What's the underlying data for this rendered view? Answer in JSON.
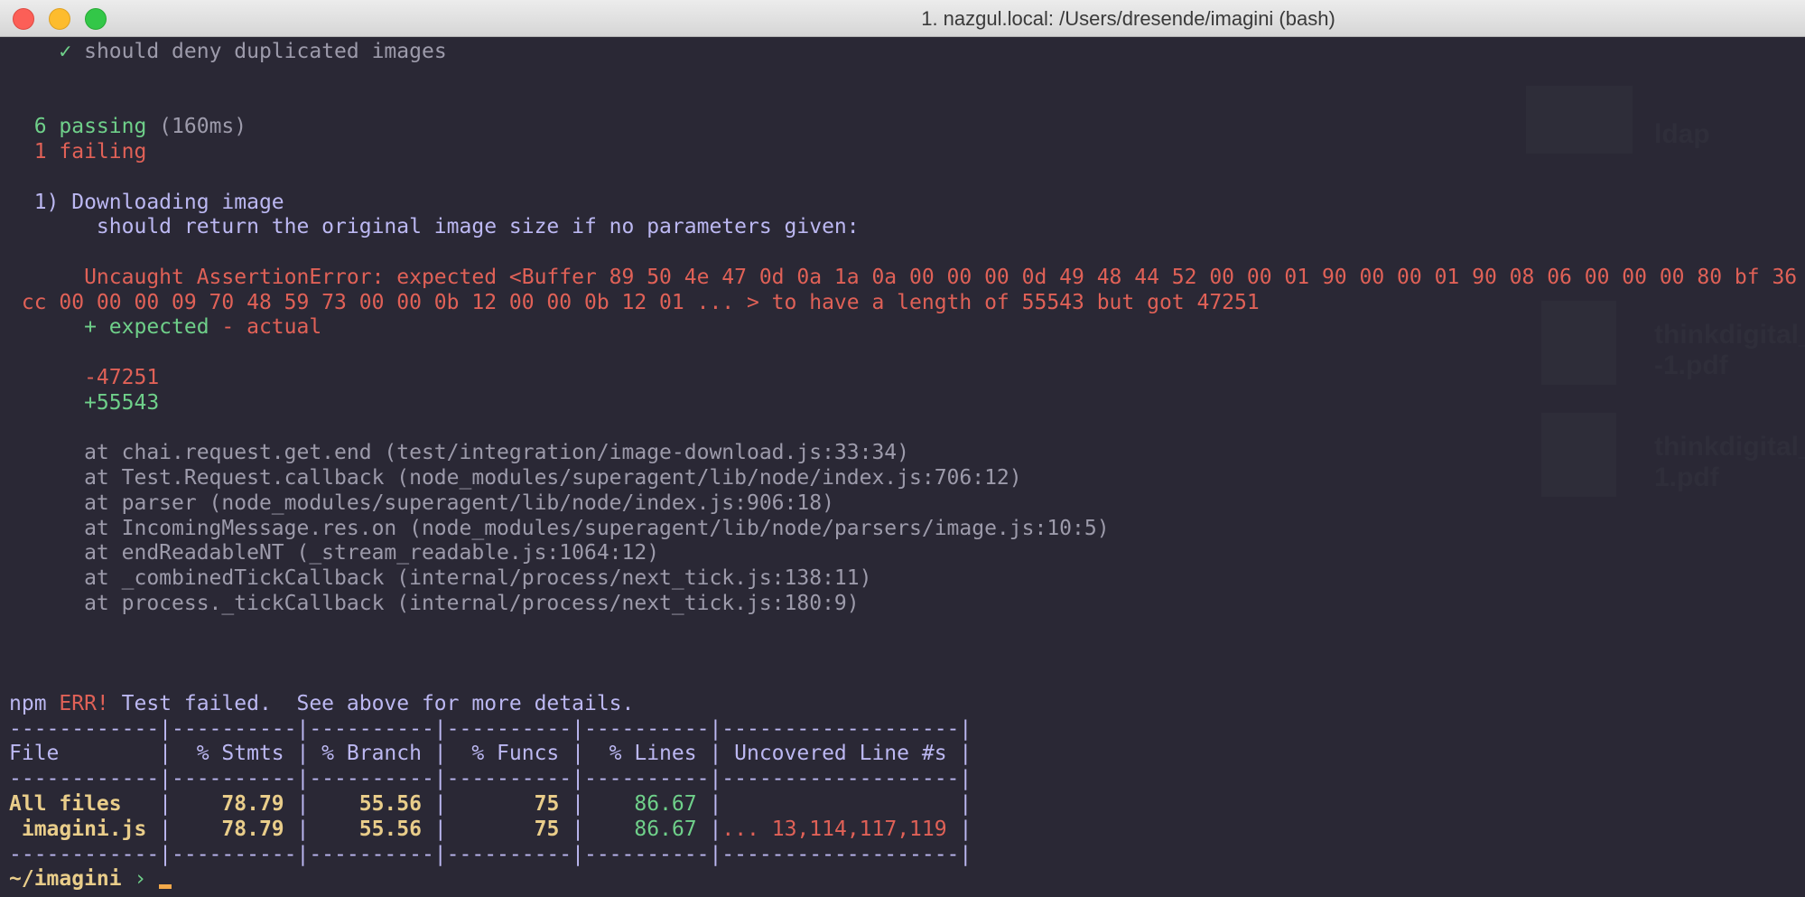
{
  "window": {
    "title": "1. nazgul.local: /Users/dresende/imagini (bash)"
  },
  "desktop": {
    "items": [
      "ldap",
      "thinkdigital_",
      "-1.pdf",
      "thinkdigital_",
      "1.pdf"
    ]
  },
  "colors": {
    "bg": "#2a2835",
    "purple": "#bcb8f2",
    "green": "#6fd08a",
    "red": "#e06157",
    "yellow": "#e9cd8a",
    "gray": "#9d9bab"
  },
  "lines": [
    [
      [
        "    ",
        "g"
      ],
      [
        "✓",
        "gr"
      ],
      [
        " should deny duplicated images",
        "g"
      ]
    ],
    [],
    [],
    [
      [
        "  6 passing",
        "gr"
      ],
      [
        " (160ms)",
        "g"
      ]
    ],
    [
      [
        "  1 failing",
        "r"
      ]
    ],
    [],
    [
      [
        "  1) Downloading image",
        "p"
      ]
    ],
    [
      [
        "       should return the original image size if no parameters given:",
        "p"
      ]
    ],
    [],
    [
      [
        "      Uncaught AssertionError: expected <Buffer 89 50 4e 47 0d 0a 1a 0a 00 00 00 0d 49 48 44 52 00 00 01 90 00 00 01 90 08 06 00 00 00 80 bf 36",
        "r"
      ]
    ],
    [
      [
        " cc 00 00 00 09 70 48 59 73 00 00 0b 12 00 00 0b 12 01 ... > to have a length of 55543 but got 47251",
        "r"
      ]
    ],
    [
      [
        "      + expected",
        "gr"
      ],
      [
        " - actual",
        "r"
      ]
    ],
    [],
    [
      [
        "      -47251",
        "r"
      ]
    ],
    [
      [
        "      +55543",
        "gr"
      ]
    ],
    [],
    [
      [
        "      at chai.request.get.end (test/integration/image-download.js:33:34)",
        "g"
      ]
    ],
    [
      [
        "      at Test.Request.callback (node_modules/superagent/lib/node/index.js:706:12)",
        "g"
      ]
    ],
    [
      [
        "      at parser (node_modules/superagent/lib/node/index.js:906:18)",
        "g"
      ]
    ],
    [
      [
        "      at IncomingMessage.res.on (node_modules/superagent/lib/node/parsers/image.js:10:5)",
        "g"
      ]
    ],
    [
      [
        "      at endReadableNT (_stream_readable.js:1064:12)",
        "g"
      ]
    ],
    [
      [
        "      at _combinedTickCallback (internal/process/next_tick.js:138:11)",
        "g"
      ]
    ],
    [
      [
        "      at process._tickCallback (internal/process/next_tick.js:180:9)",
        "g"
      ]
    ],
    [],
    [],
    [],
    [
      [
        "npm ",
        "p"
      ],
      [
        "ERR!",
        "r"
      ],
      [
        " Test failed.  See above for more details.",
        "p"
      ]
    ],
    [
      [
        "------------|----------|----------|----------|----------|-------------------|",
        "p"
      ]
    ],
    [
      [
        "File        |  % Stmts | % Branch |  % Funcs |  % Lines | Uncovered Line #s |",
        "p"
      ]
    ],
    [
      [
        "------------|----------|----------|----------|----------|-------------------|",
        "p"
      ]
    ],
    [
      [
        "All files",
        "yb"
      ],
      [
        "   |",
        "p"
      ],
      [
        "    78.79",
        "y"
      ],
      [
        " |",
        "p"
      ],
      [
        "    55.56",
        "y"
      ],
      [
        " |",
        "p"
      ],
      [
        "       75",
        "y"
      ],
      [
        " |",
        "p"
      ],
      [
        "    86.67",
        "gr"
      ],
      [
        " |                   |",
        "p"
      ]
    ],
    [
      [
        " imagini.js",
        "yb"
      ],
      [
        " |",
        "p"
      ],
      [
        "    78.79",
        "y"
      ],
      [
        " |",
        "p"
      ],
      [
        "    55.56",
        "y"
      ],
      [
        " |",
        "p"
      ],
      [
        "       75",
        "y"
      ],
      [
        " |",
        "p"
      ],
      [
        "    86.67",
        "gr"
      ],
      [
        " |",
        "p"
      ],
      [
        "... 13,114,117,119",
        "r"
      ],
      [
        " |",
        "p"
      ]
    ],
    [
      [
        "------------|----------|----------|----------|----------|-------------------|",
        "p"
      ]
    ]
  ],
  "prompt": {
    "path": "~/imagini",
    "symbol": " › "
  }
}
